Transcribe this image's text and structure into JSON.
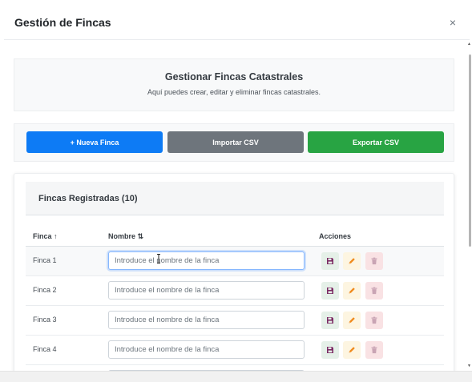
{
  "modal": {
    "title": "Gestión de Fincas",
    "close_label": "×"
  },
  "info": {
    "title": "Gestionar Fincas Catastrales",
    "description": "Aquí puedes crear, editar y eliminar fincas catastrales."
  },
  "actions": {
    "new_label": "+ Nueva Finca",
    "import_label": "Importar CSV",
    "export_label": "Exportar CSV"
  },
  "table": {
    "title": "Fincas Registradas (10)",
    "headers": {
      "finca": "Finca ↑",
      "nombre": "Nombre ⇅",
      "acciones": "Acciones"
    },
    "placeholder": "Introduce el nombre de la finca",
    "rows": [
      {
        "finca": "Finca 1",
        "nombre": ""
      },
      {
        "finca": "Finca 2",
        "nombre": ""
      },
      {
        "finca": "Finca 3",
        "nombre": ""
      },
      {
        "finca": "Finca 4",
        "nombre": ""
      }
    ],
    "icons": {
      "save": "save-icon",
      "edit": "pencil-icon",
      "delete": "trash-icon"
    }
  },
  "colors": {
    "primary": "#0d7bf5",
    "secondary": "#6e757c",
    "success": "#28a443",
    "save_icon": "#7b2a64",
    "edit_icon": "#f08a1c",
    "delete_icon": "#c9a4b4"
  }
}
